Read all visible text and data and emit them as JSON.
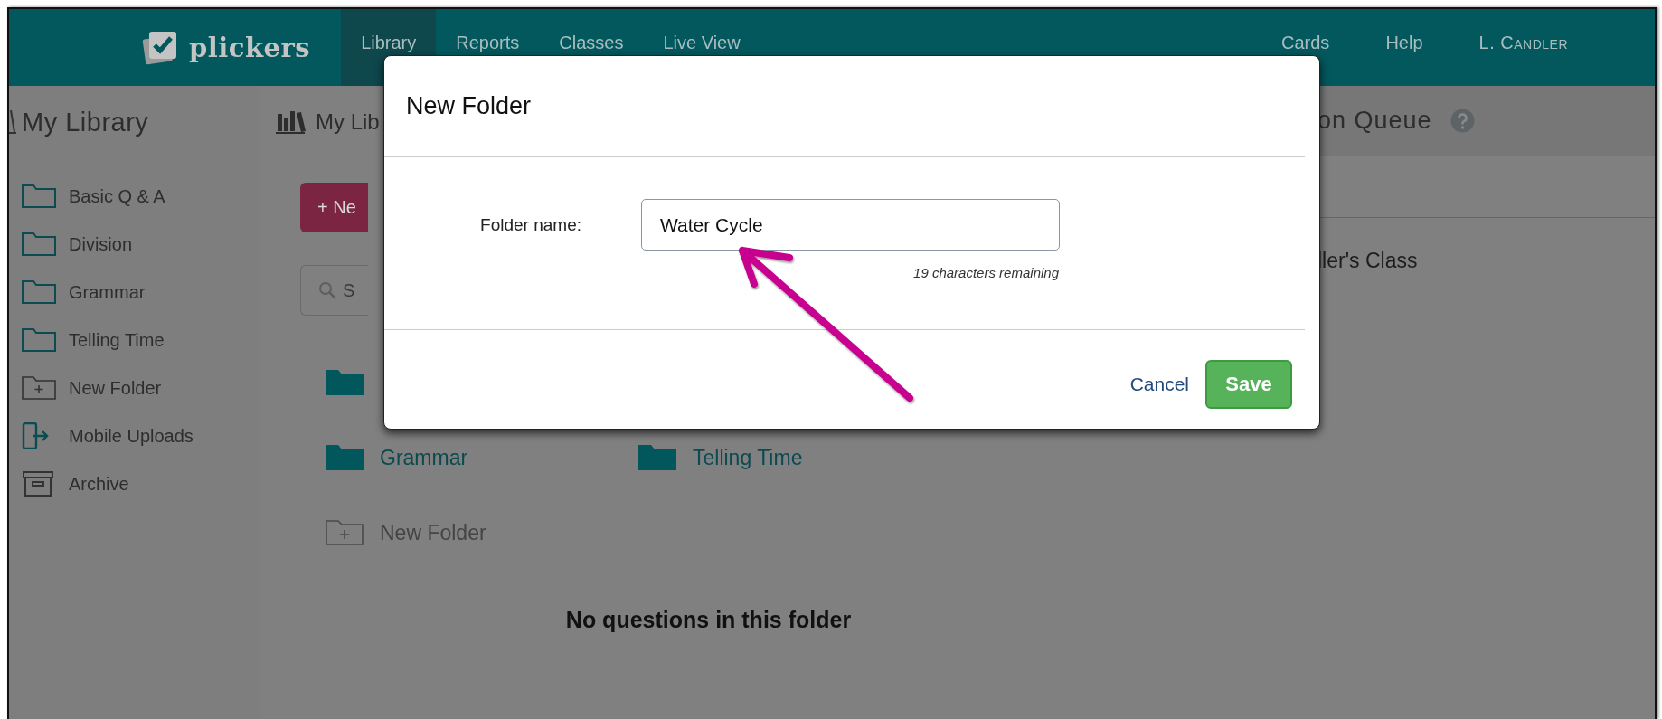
{
  "header": {
    "logo": "plickers",
    "nav": [
      {
        "label": "Library",
        "selected": true
      },
      {
        "label": "Reports",
        "selected": false
      },
      {
        "label": "Classes",
        "selected": false
      },
      {
        "label": "Live View",
        "selected": false
      }
    ],
    "right_nav": [
      "Cards",
      "Help"
    ],
    "user": "L. Candler"
  },
  "sidebar": {
    "title": "My Library",
    "items": [
      {
        "label": "Basic Q & A",
        "kind": "folder"
      },
      {
        "label": "Division",
        "kind": "folder"
      },
      {
        "label": "Grammar",
        "kind": "folder"
      },
      {
        "label": "Telling Time",
        "kind": "folder"
      },
      {
        "label": "New Folder",
        "kind": "new-folder"
      },
      {
        "label": "Mobile Uploads",
        "kind": "uploads"
      },
      {
        "label": "Archive",
        "kind": "archive"
      }
    ]
  },
  "main": {
    "title": "My Lib",
    "new_button": "+ Ne",
    "search": {
      "placeholder": "S"
    },
    "folder_rows": [
      [
        {
          "kind": "folder"
        }
      ],
      [
        {
          "kind": "folder",
          "label": "Grammar"
        },
        {
          "kind": "folder",
          "label": "Telling Time"
        }
      ],
      [
        {
          "kind": "new-folder",
          "label": "New Folder"
        }
      ]
    ],
    "empty_message": "No questions in this folder"
  },
  "queue": {
    "title": "on Queue",
    "items": [
      "ller's Class"
    ]
  },
  "dialog": {
    "title": "New Folder",
    "field": {
      "label": "Folder name:",
      "value": "Water Cycle"
    },
    "hint": "19 characters remaining",
    "buttons": [
      {
        "label": "Cancel",
        "kind": "link"
      },
      {
        "label": "Save",
        "kind": "primary"
      }
    ]
  }
}
